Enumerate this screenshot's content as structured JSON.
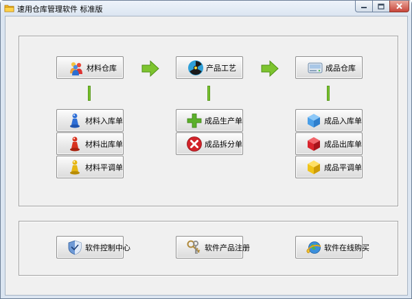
{
  "window": {
    "title": "速用仓库管理软件 标准版"
  },
  "columns": [
    {
      "main": {
        "label": "材料仓库",
        "icon": "people-group-icon"
      },
      "items": [
        {
          "label": "材料入库单",
          "icon": "blue-pawn-icon",
          "color": "#2f6fd6"
        },
        {
          "label": "材料出库单",
          "icon": "red-pawn-icon",
          "color": "#d8321e"
        },
        {
          "label": "材料平调单",
          "icon": "yellow-pawn-icon",
          "color": "#e6b612"
        }
      ]
    },
    {
      "main": {
        "label": "产品工艺",
        "icon": "radiation-icon"
      },
      "items": [
        {
          "label": "成品生产单",
          "icon": "plus-icon",
          "color": "#5bb02a"
        },
        {
          "label": "成品拆分单",
          "icon": "delete-icon",
          "color": "#d2232a"
        }
      ]
    },
    {
      "main": {
        "label": "成品仓库",
        "icon": "drive-icon"
      },
      "items": [
        {
          "label": "成品入库单",
          "icon": "blue-cube-icon",
          "color": "#4a9fe8"
        },
        {
          "label": "成品出库单",
          "icon": "red-cube-icon",
          "color": "#d9242c"
        },
        {
          "label": "成品平调单",
          "icon": "yellow-cube-icon",
          "color": "#f0c419"
        }
      ]
    }
  ],
  "bottom": [
    {
      "label": "软件控制中心",
      "icon": "shield-icon"
    },
    {
      "label": "软件产品注册",
      "icon": "keys-icon"
    },
    {
      "label": "软件在线购买",
      "icon": "globe-icon"
    }
  ],
  "colors": {
    "arrow": "#7dc42f",
    "connector": "#78c22e"
  }
}
